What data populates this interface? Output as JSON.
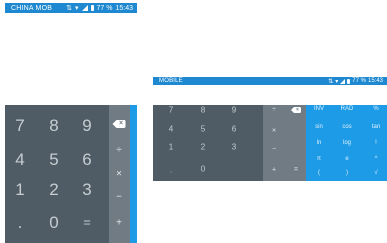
{
  "portrait": {
    "status": {
      "carrier": "CHINA MOB",
      "battery": "77 %",
      "time": "15:43",
      "icons": [
        "data-icon",
        "wifi-icon",
        "signal-icon",
        "battery-icon"
      ]
    },
    "numpad": [
      "7",
      "8",
      "9",
      "4",
      "5",
      "6",
      "1",
      "2",
      "3",
      ".",
      "0",
      "="
    ],
    "ops": [
      "÷",
      "×",
      "−",
      "+"
    ],
    "delete_icon": "backspace-icon"
  },
  "landscape": {
    "status": {
      "carrier": "MOBILE",
      "battery": "77 %",
      "time": "15:43",
      "icons": [
        "data-icon",
        "wifi-icon",
        "signal-icon",
        "battery-icon"
      ]
    },
    "numpad": [
      "7",
      "8",
      "9",
      "4",
      "5",
      "6",
      "1",
      "2",
      "3",
      ".",
      "0",
      "="
    ],
    "ops": [
      "÷",
      "×",
      "−",
      "+"
    ],
    "delete_icon": "backspace-icon",
    "sci": [
      "INV",
      "RAD",
      "%",
      "sin",
      "cos",
      "tan",
      "ln",
      "log",
      "!",
      "π",
      "e",
      "^",
      "(",
      ")",
      "√"
    ]
  },
  "colors": {
    "status_bar": "#1e88d0",
    "numpad": "#4f5c66",
    "op_pad": "#707b83",
    "sci_pad": "#1e9be6"
  }
}
